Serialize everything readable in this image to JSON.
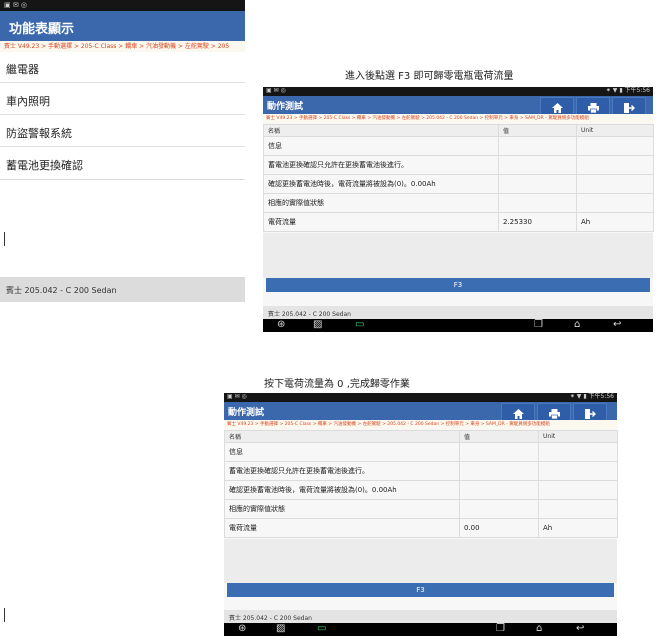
{
  "left": {
    "title": "功能表顯示",
    "breadcrumb": "賓士 V49.23 > 手動選擇 > 205-C Class > 轎車 > 汽油發動機 > 左舵駕駛 > 205",
    "menu": [
      "繼電器",
      "車內照明",
      "防盜警報系統",
      "蓄電池更換確認"
    ],
    "footer": "賓士 205.042 - C 200 Sedan"
  },
  "captions": {
    "top": "進入後點選 F3 即可歸零電瓶電荷流量",
    "bottom": "按下電荷流量為 0 ,完成歸零作業"
  },
  "shot1": {
    "status_right": "⁕ ▼ ▮ 下午5:56",
    "title": "動作測試",
    "breadcrumb": "賓士 V49.23 > 手動選擇 > 205-C Class > 轎車 > 汽油發動機 > 左舵駕駛 > 205.042 - C 200 Sedan > 控制單元 > 車身 > SAM_DR - 駕駛員側多功能模組",
    "headers": [
      "名稱",
      "值",
      "Unit"
    ],
    "rows": [
      [
        "信息",
        "",
        ""
      ],
      [
        "蓄電池更換確認只允許在更換蓄電池後進行。",
        "",
        ""
      ],
      [
        "確認更換蓄電池時後，電荷流量將被設為(0)。0.00Ah",
        "",
        ""
      ],
      [
        "相應的實際值狀態",
        "",
        ""
      ],
      [
        "電荷流量",
        "2.25330",
        "Ah"
      ]
    ],
    "f3": "F3",
    "footer": "賓士 205.042 - C 200 Sedan"
  },
  "shot2": {
    "status_right": "⁕ ▼ ▮ 下午5:56",
    "title": "動作測試",
    "breadcrumb": "賓士 V49.23 > 手動選擇 > 205-C Class > 轎車 > 汽油發動機 > 左舵駕駛 > 205.042 - C 200 Sedan > 控制單元 > 車身 > SAM_DR - 駕駛員側多功能模組",
    "headers": [
      "名稱",
      "值",
      "Unit"
    ],
    "rows": [
      [
        "信息",
        "",
        ""
      ],
      [
        "蓄電池更換確認只允許在更換蓄電池後進行。",
        "",
        ""
      ],
      [
        "確認更換蓄電池時後，電荷流量將被設為(0)。0.00Ah",
        "",
        ""
      ],
      [
        "相應的實際值狀態",
        "",
        ""
      ],
      [
        "電荷流量",
        "0.00",
        "Ah"
      ]
    ],
    "f3": "F3",
    "footer": "賓士 205.042 - C 200 Sedan"
  },
  "icons": {
    "home": "home-icon",
    "print": "printer-icon",
    "exit": "exit-icon",
    "app": "app-logo-icon",
    "gallery": "gallery-icon",
    "battery": "battery-icon",
    "recents": "recent-apps-icon",
    "nav_home": "nav-home-icon",
    "back": "back-icon"
  },
  "colors": {
    "titlebar": "#3b68ad",
    "crumb_text": "#d9451f",
    "f3_button": "#3a6db1",
    "status_bar": "#151515"
  }
}
